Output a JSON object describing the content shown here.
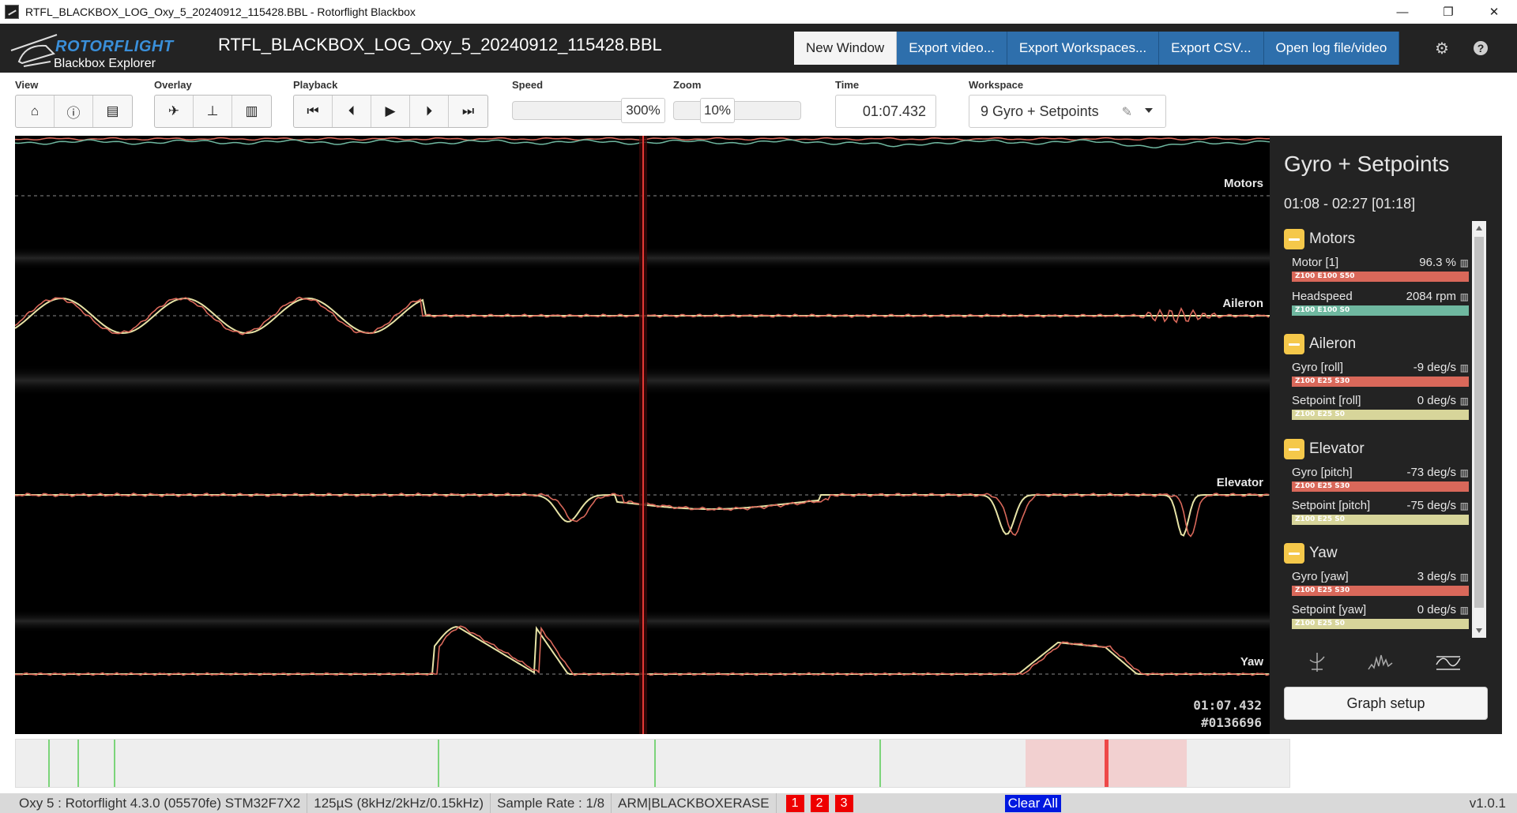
{
  "window": {
    "title": "RTFL_BLACKBOX_LOG_Oxy_5_20240912_115428.BBL - Rotorflight Blackbox",
    "controls": {
      "minimize": "—",
      "restore": "❐",
      "close": "✕"
    }
  },
  "header": {
    "brand": "ROTORFLIGHT",
    "product": "Blackbox Explorer",
    "log_title": "RTFL_BLACKBOX_LOG_Oxy_5_20240912_115428.BBL",
    "buttons": [
      "New Window",
      "Export video...",
      "Export Workspaces...",
      "Export CSV...",
      "Open log file/video"
    ],
    "icons": [
      "gear-icon",
      "help-icon"
    ]
  },
  "toolbar": {
    "view_label": "View",
    "overlay_label": "Overlay",
    "playback_label": "Playback",
    "speed_label": "Speed",
    "speed_value": "300%",
    "zoom_label": "Zoom",
    "zoom_value": "10%",
    "time_label": "Time",
    "time_value": "01:07.432",
    "workspace_label": "Workspace",
    "workspace_value": "9 Gyro + Setpoints"
  },
  "graph": {
    "labels": {
      "motors": "Motors",
      "aileron": "Aileron",
      "elevator": "Elevator",
      "yaw": "Yaw"
    },
    "cursor_time": "01:07.432",
    "cursor_frame": "#0136696",
    "colors": {
      "gyro": "#d9685a",
      "setpoint": "#e7e3a6",
      "motor": "#d9685a",
      "headspeed": "#6fb8a0",
      "cursor": "#e53935"
    }
  },
  "panel": {
    "title": "Gyro + Setpoints",
    "range": "01:08 - 02:27 [01:18]",
    "groups": [
      {
        "name": "Motors",
        "fields": [
          {
            "name": "Motor [1]",
            "value": "96.3 %",
            "strip": "Z100 E100 S50",
            "color": "#d9685a"
          },
          {
            "name": "Headspeed",
            "value": "2084 rpm",
            "strip": "Z100 E100 S0",
            "color": "#6fb8a0"
          }
        ]
      },
      {
        "name": "Aileron",
        "fields": [
          {
            "name": "Gyro [roll]",
            "value": "-9 deg/s",
            "strip": "Z100 E25 S30",
            "color": "#d9685a"
          },
          {
            "name": "Setpoint [roll]",
            "value": "0 deg/s",
            "strip": "Z100 E25 S0",
            "color": "#d7d59a"
          }
        ]
      },
      {
        "name": "Elevator",
        "fields": [
          {
            "name": "Gyro [pitch]",
            "value": "-73 deg/s",
            "strip": "Z100 E25 S30",
            "color": "#d9685a"
          },
          {
            "name": "Setpoint [pitch]",
            "value": "-75 deg/s",
            "strip": "Z100 E25 S0",
            "color": "#d7d59a"
          }
        ]
      },
      {
        "name": "Yaw",
        "fields": [
          {
            "name": "Gyro [yaw]",
            "value": "3 deg/s",
            "strip": "Z100 E25 S30",
            "color": "#d9685a"
          },
          {
            "name": "Setpoint [yaw]",
            "value": "0 deg/s",
            "strip": "Z100 E25 S0",
            "color": "#d7d59a"
          }
        ]
      }
    ],
    "graph_setup": "Graph setup"
  },
  "statusbar": {
    "items": [
      "Oxy 5 : Rotorflight 4.3.0 (05570fe) STM32F7X2",
      "125µS (8kHz/2kHz/0.15kHz)",
      "Sample Rate : 1/8",
      "ARM|BLACKBOXERASE"
    ],
    "markers": [
      "1",
      "2",
      "3"
    ],
    "clear_all": "Clear All",
    "version": "v1.0.1"
  }
}
